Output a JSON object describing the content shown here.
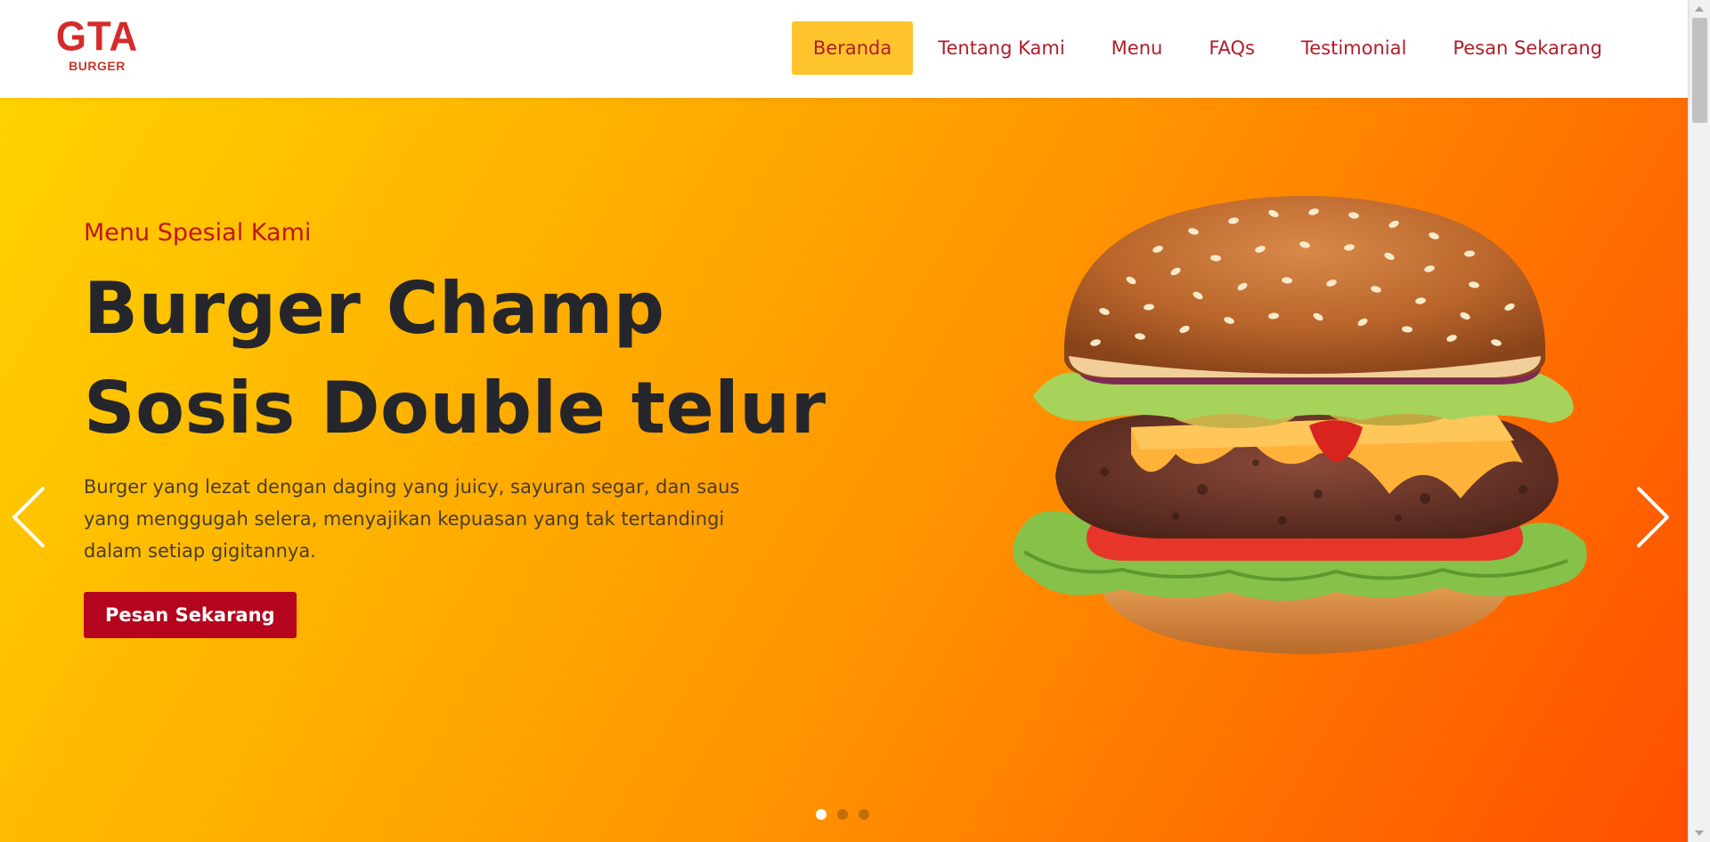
{
  "brand": {
    "logo_main": "GTA",
    "logo_sub": "BURGER"
  },
  "nav": {
    "items": [
      {
        "label": "Beranda",
        "active": true
      },
      {
        "label": "Tentang Kami",
        "active": false
      },
      {
        "label": "Menu",
        "active": false
      },
      {
        "label": "FAQs",
        "active": false
      },
      {
        "label": "Testimonial",
        "active": false
      },
      {
        "label": "Pesan Sekarang",
        "active": false
      }
    ]
  },
  "hero": {
    "eyebrow": "Menu Spesial Kami",
    "title_line1": "Burger Champ",
    "title_line2": "Sosis Double telur",
    "description": "Burger yang lezat dengan daging yang juicy, sayuran segar, dan saus yang menggugah selera, menyajikan kepuasan yang tak tertandingi dalam setiap gigitannya.",
    "cta_label": "Pesan Sekarang"
  },
  "carousel": {
    "slide_count": 3,
    "active_index": 0
  },
  "colors": {
    "accent": "#b5041d",
    "nav_active_bg": "#ffc42b",
    "nav_text": "#b01d2a",
    "title_text": "#24262b",
    "hero_gradient_start": "#ffd200",
    "hero_gradient_end": "#ff4f00"
  },
  "icons": {
    "prev": "chevron-left-icon",
    "next": "chevron-right-icon"
  }
}
